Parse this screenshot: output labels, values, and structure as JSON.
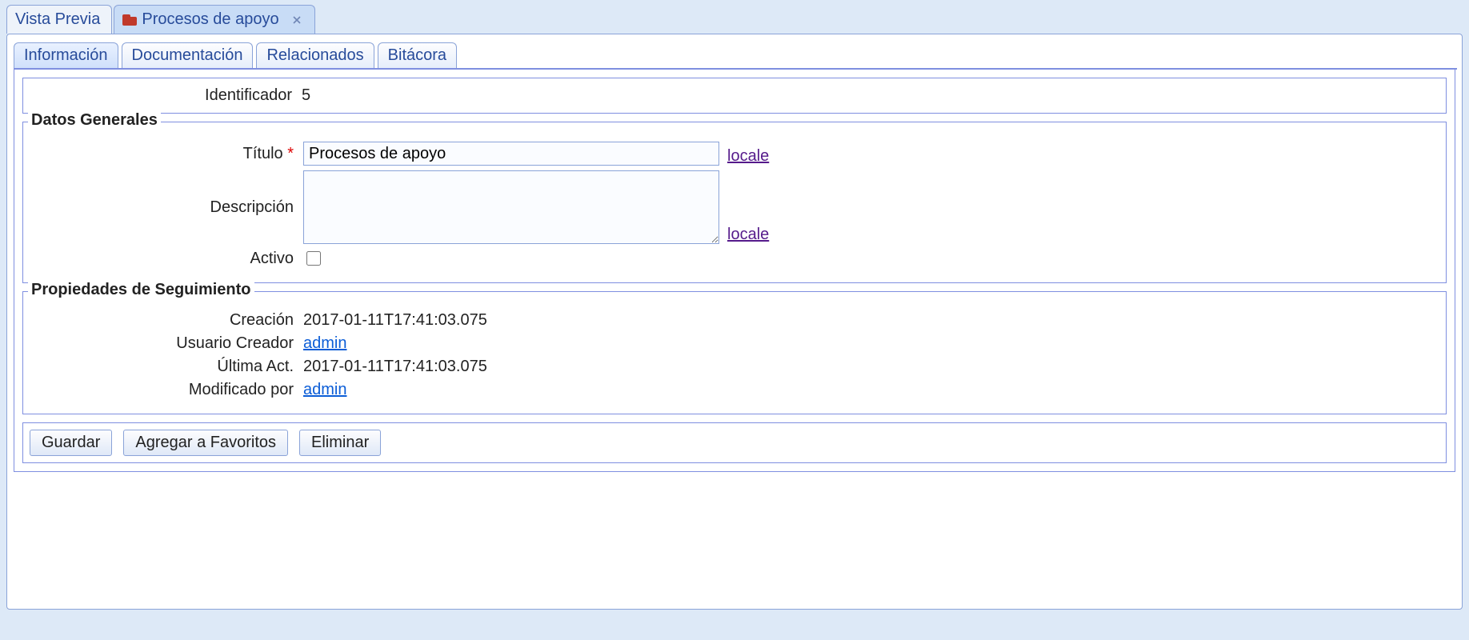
{
  "window_tabs": {
    "preview": "Vista Previa",
    "procesos": "Procesos de apoyo"
  },
  "inner_tabs": {
    "informacion": "Información",
    "documentacion": "Documentación",
    "relacionados": "Relacionados",
    "bitacora": "Bitácora"
  },
  "identificador": {
    "label": "Identificador",
    "value": "5"
  },
  "datos_generales": {
    "legend": "Datos Generales",
    "titulo_label": "Título",
    "titulo_value": "Procesos de apoyo",
    "descripcion_label": "Descripción",
    "descripcion_value": "",
    "activo_label": "Activo",
    "locale_link": "locale"
  },
  "seguimiento": {
    "legend": "Propiedades de Seguimiento",
    "creacion_label": "Creación",
    "creacion_value": "2017-01-11T17:41:03.075",
    "usuario_creador_label": "Usuario Creador",
    "usuario_creador_value": "admin",
    "ultima_act_label": "Última Act.",
    "ultima_act_value": "2017-01-11T17:41:03.075",
    "modificado_por_label": "Modificado por",
    "modificado_por_value": "admin"
  },
  "buttons": {
    "guardar": "Guardar",
    "favoritos": "Agregar a Favoritos",
    "eliminar": "Eliminar"
  }
}
